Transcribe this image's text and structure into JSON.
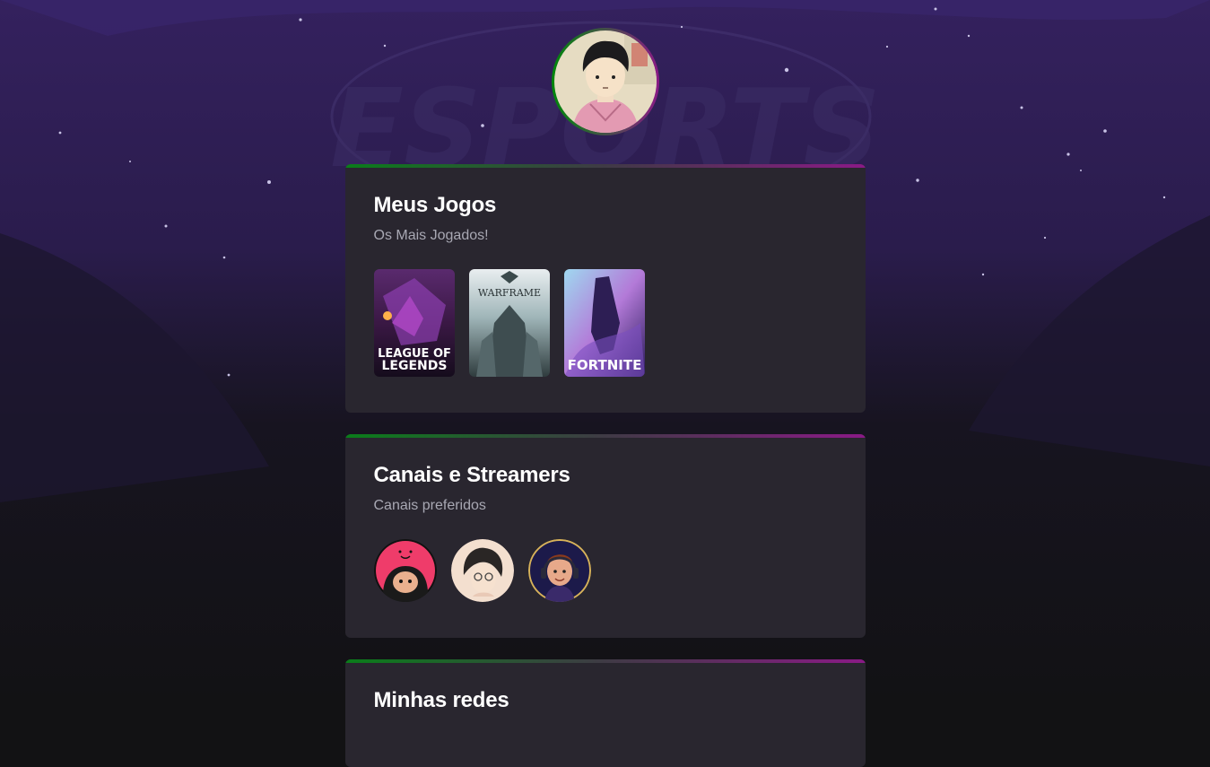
{
  "colors": {
    "background": "#121214",
    "card": "#29262f",
    "accent_green": "#00870a",
    "accent_purple": "#8a1a86"
  },
  "profile": {
    "avatar_icon": "profile-avatar-illustration"
  },
  "sections": {
    "games": {
      "title": "Meus Jogos",
      "subtitle": "Os Mais Jogados!",
      "items": [
        {
          "name": "League of Legends",
          "logo_line1": "LEAGUE OF",
          "logo_line2": "LEGENDS"
        },
        {
          "name": "Warframe",
          "logo": "WARFRAME"
        },
        {
          "name": "Fortnite",
          "logo": "FORTNITE"
        }
      ]
    },
    "streamers": {
      "title": "Canais e Streamers",
      "subtitle": "Canais preferidos",
      "items": [
        {
          "icon": "streamer-avatar-pink"
        },
        {
          "icon": "streamer-avatar-glasses"
        },
        {
          "icon": "streamer-avatar-headset"
        }
      ]
    },
    "social": {
      "title": "Minhas redes"
    }
  }
}
